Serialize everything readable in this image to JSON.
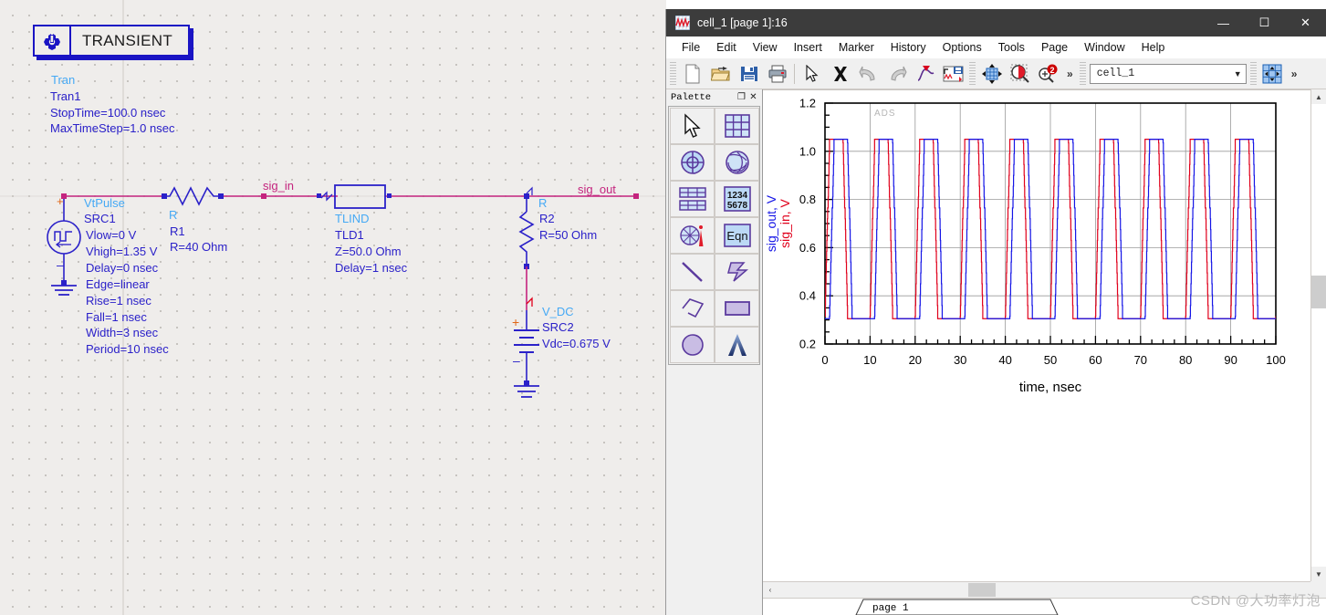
{
  "schematic": {
    "transient_block": {
      "icon": "transient-gear-icon",
      "title": "TRANSIENT",
      "type_label": "Tran",
      "instance": "Tran1",
      "params": [
        "StopTime=100.0 nsec",
        "MaxTimeStep=1.0 nsec"
      ]
    },
    "source_vtpulse": {
      "type_label": "VtPulse",
      "instance": "SRC1",
      "params": [
        "Vlow=0 V",
        "Vhigh=1.35 V",
        "Delay=0 nsec",
        "Edge=linear",
        "Rise=1 nsec",
        "Fall=1 nsec",
        "Width=3 nsec",
        "Period=10 nsec"
      ]
    },
    "resistor_r1": {
      "type_label": "R",
      "instance": "R1",
      "value": "R=40 Ohm"
    },
    "tline": {
      "type_label": "TLIND",
      "instance": "TLD1",
      "params": [
        "Z=50.0 Ohm",
        "Delay=1 nsec"
      ]
    },
    "resistor_r2": {
      "type_label": "R",
      "instance": "R2",
      "value": "R=50 Ohm"
    },
    "source_vdc": {
      "type_label": "V_DC",
      "instance": "SRC2",
      "value": "Vdc=0.675 V"
    },
    "net_labels": {
      "input": "sig_in",
      "output": "sig_out"
    },
    "colors": {
      "wire": "#c4247e",
      "device": "#2b21c9",
      "type": "#45a9f5"
    }
  },
  "window": {
    "title": "cell_1 [page 1]:16",
    "app_icon": "waveform-icon",
    "buttons": {
      "minimize": "—",
      "maximize": "☐",
      "close": "✕"
    },
    "menu": [
      "File",
      "Edit",
      "View",
      "Insert",
      "Marker",
      "History",
      "Options",
      "Tools",
      "Page",
      "Window",
      "Help"
    ],
    "toolbar": {
      "icons": [
        "new-document-icon",
        "open-folder-icon",
        "save-disk-icon",
        "print-icon",
        "select-arrow-icon",
        "delete-x-icon",
        "undo-icon",
        "redo-icon",
        "curve-marker-icon",
        "save-dataset-icon",
        "move-icon",
        "zoom-area-icon",
        "zoom-in-2-icon"
      ],
      "overflow": "»",
      "overflow2": "»",
      "combo_value": "cell_1",
      "combo_arrow": "▼",
      "last_icon": "pan-grid-icon"
    },
    "palette": {
      "title": "Palette",
      "undock_btn": "❐",
      "close_btn": "✕",
      "items": [
        "pointer-icon",
        "rect-plot-icon",
        "polar-plot-icon",
        "smith-chart-icon",
        "list-table-icon",
        "data-table-icon",
        "antenna-plot-icon",
        "equation-icon",
        "line-tool-icon",
        "arrow-shape-icon",
        "polyline-icon",
        "rectangle-icon",
        "circle-icon",
        "text-tool-icon"
      ],
      "table_numbers": [
        "1234",
        "5678"
      ],
      "eqn_label": "Eqn",
      "text_glyph": "A"
    },
    "statusbar": {
      "page_tab": "page 1",
      "hscroll_left": "‹"
    }
  },
  "watermark": "CSDN @大功率灯泡",
  "chart_data": {
    "type": "line",
    "title": "",
    "watermark": "ADS",
    "xlabel": "time, nsec",
    "ylabel_out": "sig_out, V",
    "ylabel_in": "sig_in, V",
    "xlim": [
      0,
      100
    ],
    "ylim": [
      0.2,
      1.2
    ],
    "xticks": [
      0,
      10,
      20,
      30,
      40,
      50,
      60,
      70,
      80,
      90,
      100
    ],
    "yticks": [
      0.2,
      0.4,
      0.6,
      0.8,
      1.0,
      1.2
    ],
    "grid": true,
    "legend_position": "axis-labels",
    "series": [
      {
        "name": "sig_in, V",
        "color": "#e0001b",
        "low": 0.305,
        "high": 1.05,
        "period": 10,
        "width": 3,
        "rise": 1,
        "fall": 1,
        "delay": 0,
        "cycles": 10
      },
      {
        "name": "sig_out, V",
        "color": "#1414e6",
        "low": 0.305,
        "high": 1.05,
        "period": 10,
        "width": 3,
        "rise": 1,
        "fall": 1,
        "delay": 1,
        "cycles": 10
      }
    ]
  }
}
